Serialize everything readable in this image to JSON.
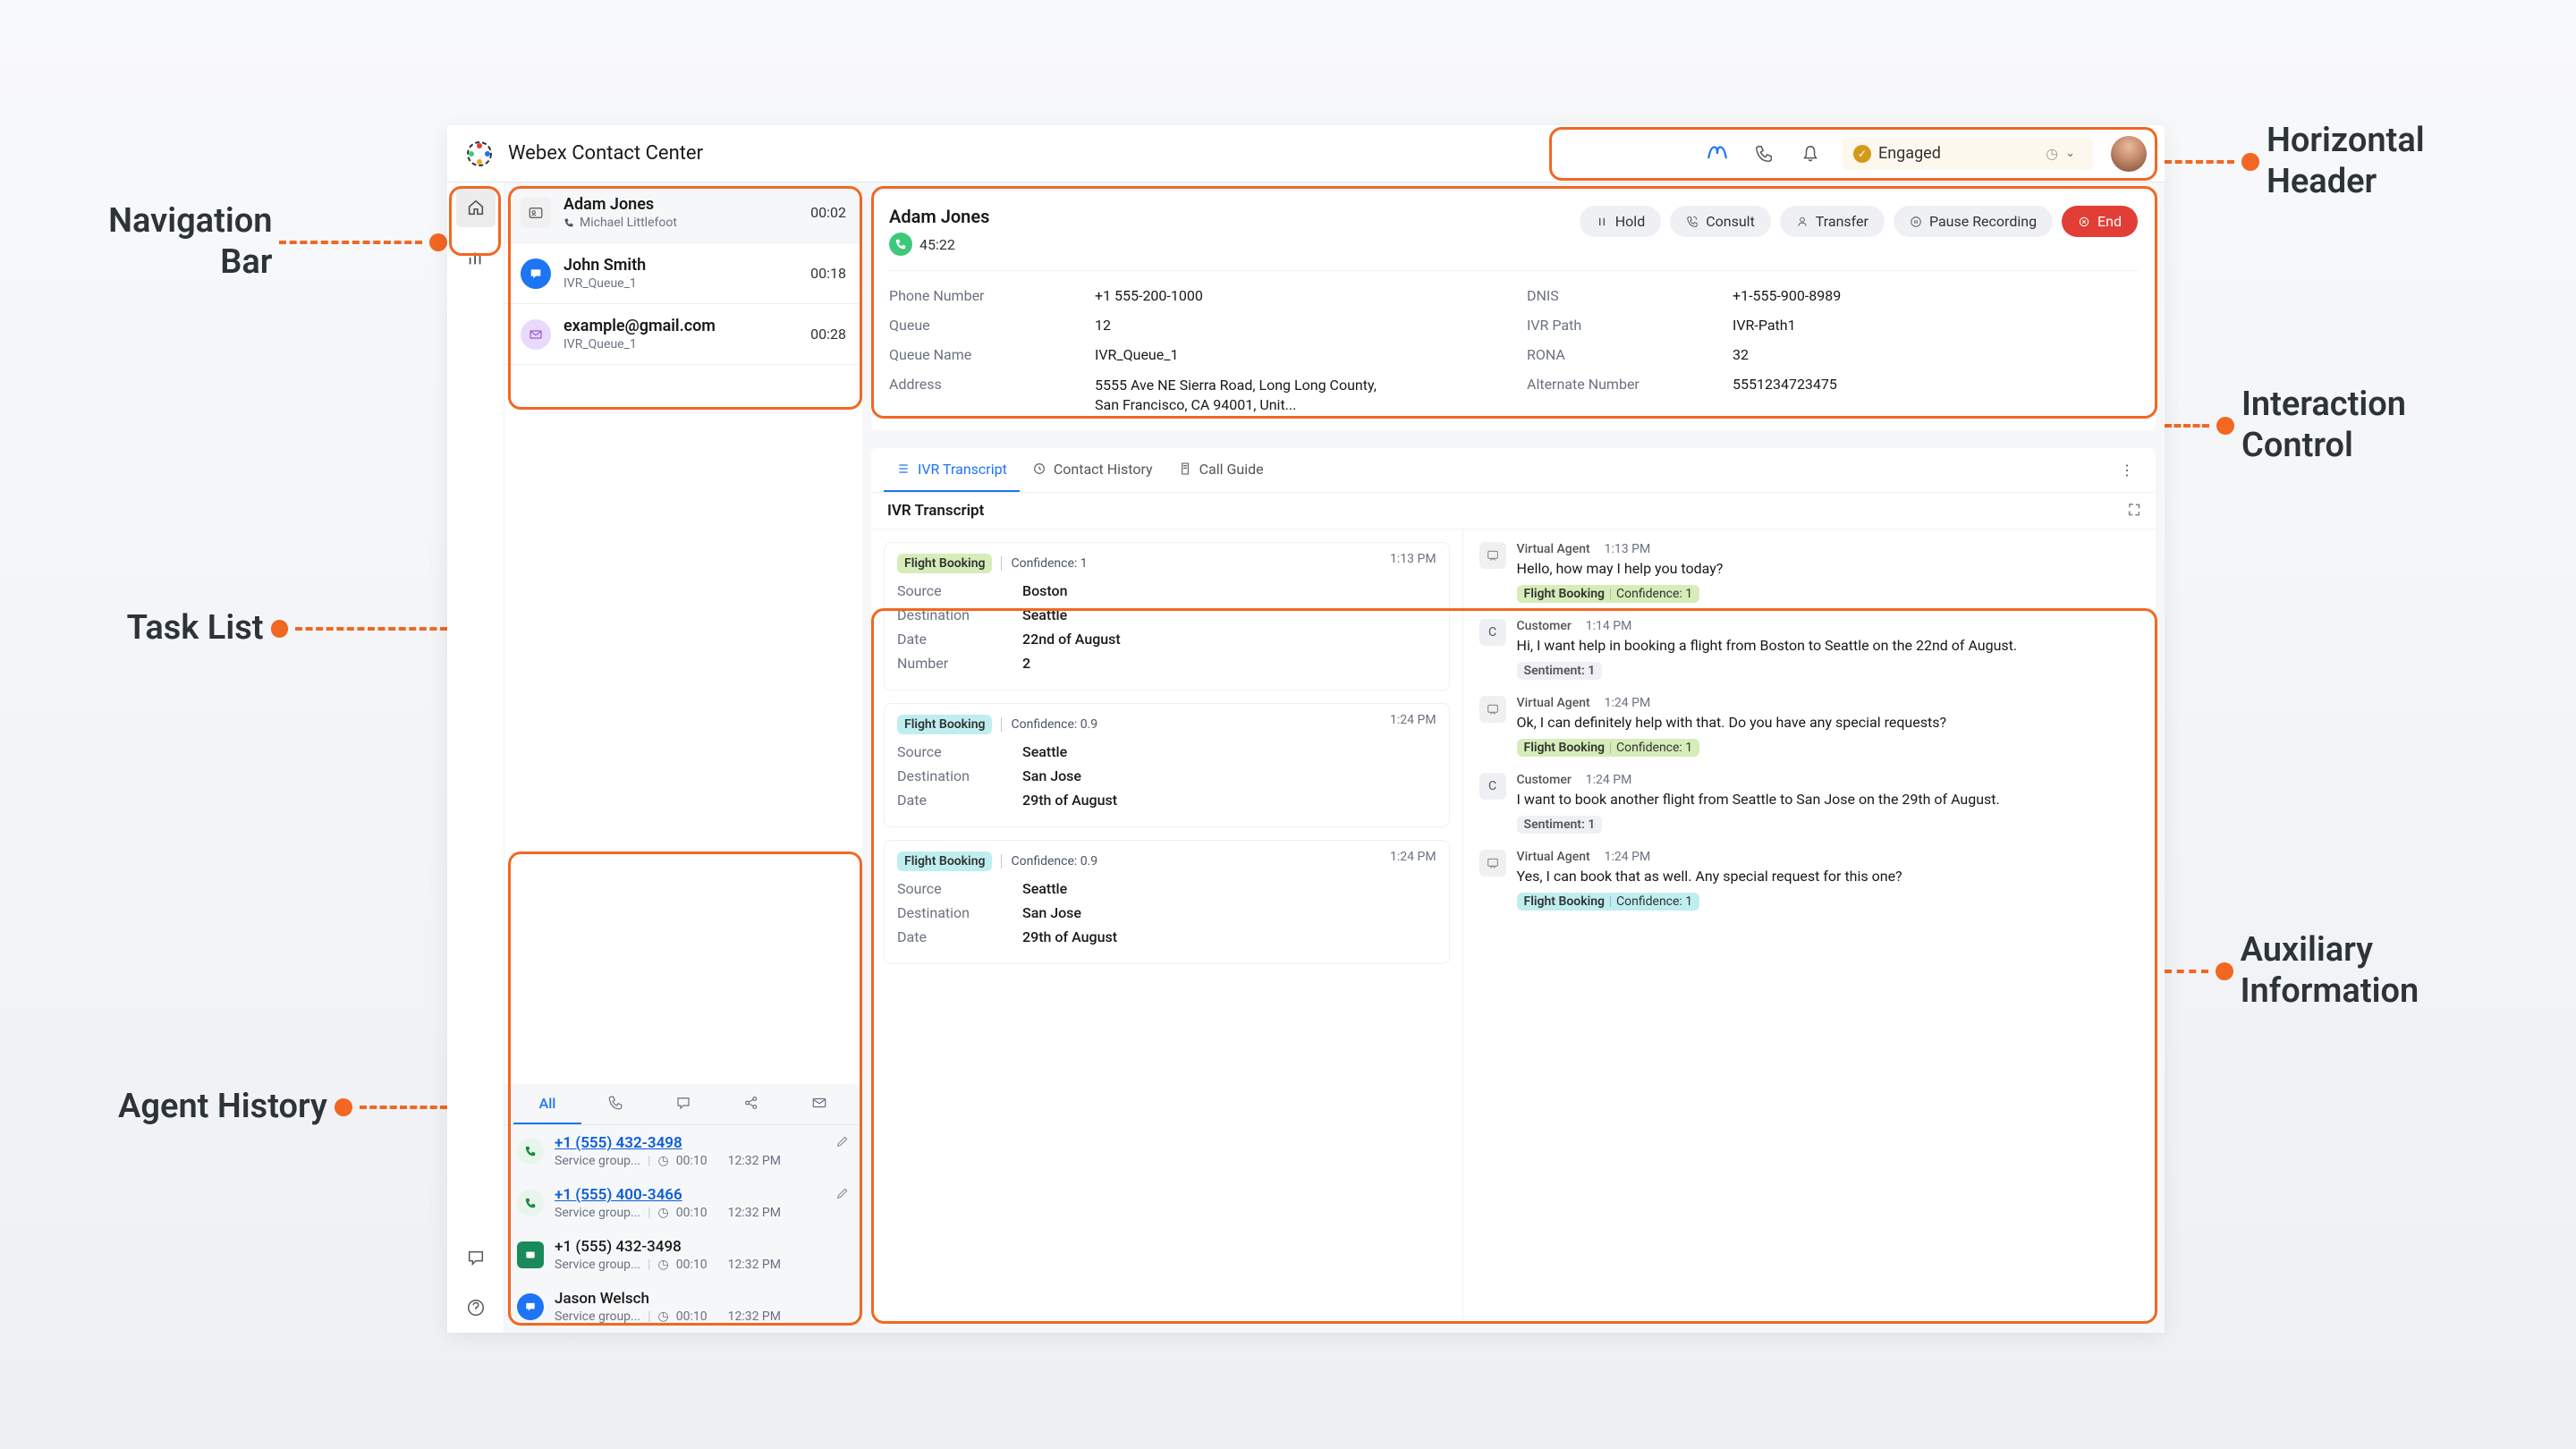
{
  "annotations": {
    "nav": "Navigation\nBar",
    "tasklist": "Task List",
    "history": "Agent History",
    "header": "Horizontal\nHeader",
    "interaction": "Interaction\nControl",
    "aux": "Auxiliary\nInformation"
  },
  "header": {
    "title": "Webex Contact Center",
    "status": "Engaged"
  },
  "tasks": [
    {
      "name": "Adam Jones",
      "sub": "Michael Littlefoot",
      "time": "00:02",
      "icon": "card"
    },
    {
      "name": "John Smith",
      "sub": "IVR_Queue_1",
      "time": "00:18",
      "icon": "chat"
    },
    {
      "name": "example@gmail.com",
      "sub": "IVR_Queue_1",
      "time": "00:28",
      "icon": "email"
    }
  ],
  "interaction": {
    "contact": "Adam Jones",
    "timer": "45:22",
    "actions": {
      "hold": "Hold",
      "consult": "Consult",
      "transfer": "Transfer",
      "pause": "Pause Recording",
      "end": "End"
    },
    "fields": {
      "phone_l": "Phone Number",
      "phone_v": "+1 555-200-1000",
      "dnis_l": "DNIS",
      "dnis_v": "+1-555-900-8989",
      "queue_l": "Queue",
      "queue_v": "12",
      "ivrpath_l": "IVR Path",
      "ivrpath_v": "IVR-Path1",
      "qname_l": "Queue Name",
      "qname_v": "IVR_Queue_1",
      "rona_l": "RONA",
      "rona_v": "32",
      "addr_l": "Address",
      "addr_v": "5555 Ave NE Sierra Road, Long Long County, San Francisco, CA 94001, Unit...",
      "alt_l": "Alternate Number",
      "alt_v": "5551234723475"
    }
  },
  "aux": {
    "tabs": {
      "ivr": "IVR Transcript",
      "contact": "Contact History",
      "guide": "Call Guide"
    },
    "section_title": "IVR Transcript",
    "cards": [
      {
        "intent": "Flight Booking",
        "confidence": "Confidence: 1",
        "color": "green",
        "time": "1:13 PM",
        "rows": [
          {
            "k": "Source",
            "v": "Boston"
          },
          {
            "k": "Destination",
            "v": "Seattle"
          },
          {
            "k": "Date",
            "v": "22nd of August"
          },
          {
            "k": "Number",
            "v": "2"
          }
        ]
      },
      {
        "intent": "Flight Booking",
        "confidence": "Confidence: 0.9",
        "color": "teal",
        "time": "1:24 PM",
        "rows": [
          {
            "k": "Source",
            "v": "Seattle"
          },
          {
            "k": "Destination",
            "v": "San Jose"
          },
          {
            "k": "Date",
            "v": "29th of August"
          }
        ]
      },
      {
        "intent": "Flight Booking",
        "confidence": "Confidence: 0.9",
        "color": "teal",
        "time": "1:24 PM",
        "rows": [
          {
            "k": "Source",
            "v": "Seattle"
          },
          {
            "k": "Destination",
            "v": "San Jose"
          },
          {
            "k": "Date",
            "v": "29th of August"
          }
        ]
      }
    ],
    "conversation": [
      {
        "who": "Virtual Agent",
        "time": "1:13 PM",
        "avatar": "agent",
        "text": "Hello, how may I help you today?",
        "pills": [
          {
            "t": "Flight Booking",
            "s": "Confidence: 1",
            "c": "green"
          }
        ]
      },
      {
        "who": "Customer",
        "time": "1:14 PM",
        "avatar": "C",
        "text": "Hi, I want help in booking a flight from Boston to Seattle on the 22nd of August.",
        "pills": [
          {
            "t": "Sentiment: 1",
            "c": "gray"
          }
        ]
      },
      {
        "who": "Virtual Agent",
        "time": "1:24 PM",
        "avatar": "agent",
        "text": "Ok, I can definitely help with that. Do you have any special requests?",
        "pills": [
          {
            "t": "Flight Booking",
            "s": "Confidence: 1",
            "c": "green"
          }
        ]
      },
      {
        "who": "Customer",
        "time": "1:24 PM",
        "avatar": "C",
        "text": "I want to book another flight from Seattle to San Jose on the 29th of August.",
        "pills": [
          {
            "t": "Sentiment: 1",
            "c": "gray"
          }
        ]
      },
      {
        "who": "Virtual Agent",
        "time": "1:24 PM",
        "avatar": "agent",
        "text": "Yes, I can book that as well. Any special request for this one?",
        "pills": [
          {
            "t": "Flight Booking",
            "s": "Confidence: 1",
            "c": "teal"
          }
        ]
      }
    ]
  },
  "history": {
    "tabs": {
      "all": "All"
    },
    "items": [
      {
        "title": "+1 (555) 432-3498",
        "link": true,
        "icon": "phone",
        "sub": "Service group...",
        "dur": "00:10",
        "time": "12:32 PM",
        "edit": true
      },
      {
        "title": "+1 (555) 400-3466",
        "link": true,
        "icon": "phone",
        "sub": "Service group...",
        "dur": "00:10",
        "time": "12:32 PM",
        "edit": true
      },
      {
        "title": "+1 (555) 432-3498",
        "link": false,
        "icon": "sms",
        "sub": "Service group...",
        "dur": "00:10",
        "time": "12:32 PM"
      },
      {
        "title": "Jason Welsch",
        "link": false,
        "icon": "chat",
        "sub": "Service group...",
        "dur": "00:10",
        "time": "12:32 PM"
      }
    ]
  }
}
